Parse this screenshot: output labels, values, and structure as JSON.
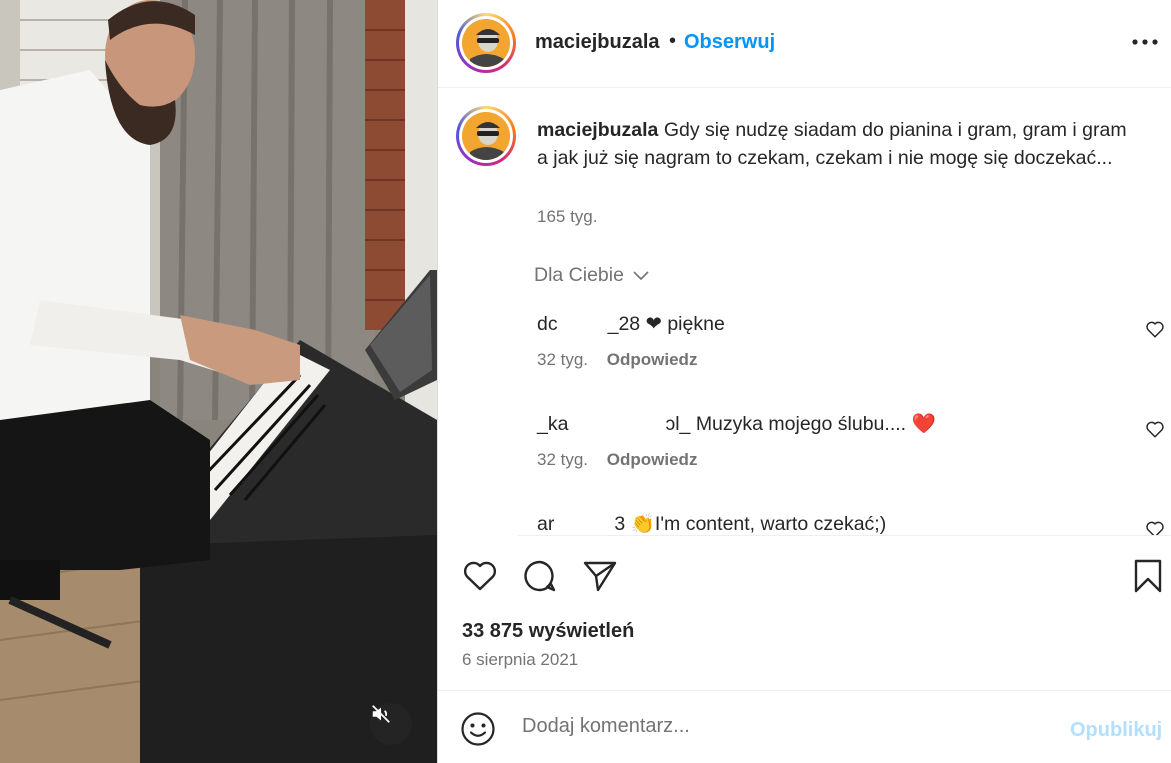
{
  "post": {
    "username": "maciejbuzala",
    "separator": "•",
    "follow_label": "Obserwuj",
    "more_icon": "more-horizontal-icon"
  },
  "caption": {
    "username": "maciejbuzala",
    "text": "Gdy się nudzę siadam do pianina i gram, gram i gram a jak już się nagram to czekam, czekam i nie mogę się doczekać...",
    "time": "165 tyg."
  },
  "for_you": {
    "label": "Dla Ciebie"
  },
  "comments": [
    {
      "user_start": "dc",
      "user_end": "_28",
      "text": "❤ piękne",
      "time": "32 tyg.",
      "reply": "Odpowiedz"
    },
    {
      "user_start": "_ka",
      "user_end": "ɔl_",
      "text": "Muzyka mojego ślubu.... ❤️",
      "time": "32 tyg.",
      "reply": "Odpowiedz"
    },
    {
      "user_start": "ar",
      "user_end": "3",
      "text": "👏I'm content, warto czekać;)",
      "time": "",
      "reply": ""
    }
  ],
  "stats": {
    "views": "33 875 wyświetleń",
    "date": "6 sierpnia 2021"
  },
  "add_comment": {
    "placeholder": "Dodaj komentarz...",
    "publish": "Opublikuj"
  },
  "colors": {
    "accent": "#0095f6",
    "publish_disabled": "#b2dffc",
    "muted": "#737373"
  }
}
